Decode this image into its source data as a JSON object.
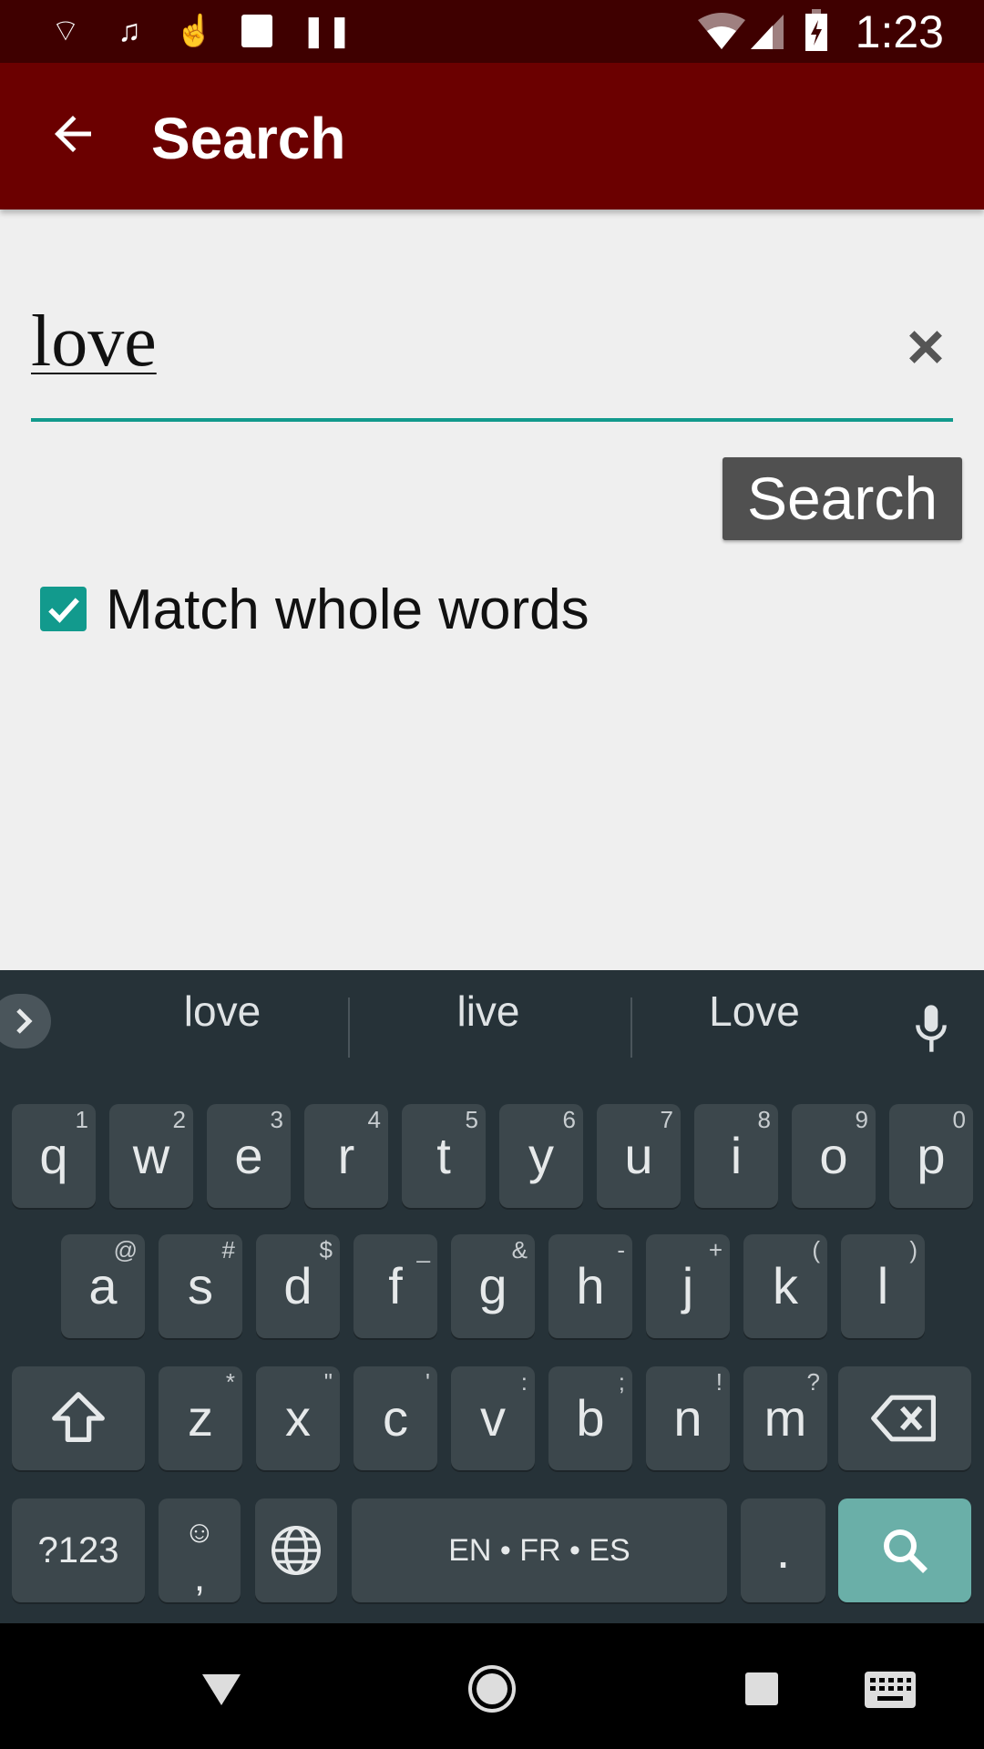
{
  "status_bar": {
    "time": "1:23",
    "left_icons": [
      "cast-wifi-icon",
      "music-icon",
      "touch-icon",
      "image-icon",
      "pause-icon"
    ],
    "right_icons": [
      "wifi-icon",
      "signal-icon",
      "battery-charging-icon"
    ]
  },
  "app_bar": {
    "title": "Search",
    "color": "#6b0000"
  },
  "search": {
    "query": "love",
    "button_label": "Search",
    "match_whole_words_label": "Match whole words",
    "match_whole_words_checked": true,
    "accent": "#129a8d"
  },
  "keyboard": {
    "suggestions": [
      "love",
      "live",
      "Love"
    ],
    "row1": [
      {
        "k": "q",
        "h": "1"
      },
      {
        "k": "w",
        "h": "2"
      },
      {
        "k": "e",
        "h": "3"
      },
      {
        "k": "r",
        "h": "4"
      },
      {
        "k": "t",
        "h": "5"
      },
      {
        "k": "y",
        "h": "6"
      },
      {
        "k": "u",
        "h": "7"
      },
      {
        "k": "i",
        "h": "8"
      },
      {
        "k": "o",
        "h": "9"
      },
      {
        "k": "p",
        "h": "0"
      }
    ],
    "row2": [
      {
        "k": "a",
        "h": "@"
      },
      {
        "k": "s",
        "h": "#"
      },
      {
        "k": "d",
        "h": "$"
      },
      {
        "k": "f",
        "h": "_"
      },
      {
        "k": "g",
        "h": "&"
      },
      {
        "k": "h",
        "h": "-"
      },
      {
        "k": "j",
        "h": "+"
      },
      {
        "k": "k",
        "h": "("
      },
      {
        "k": "l",
        "h": ")"
      }
    ],
    "row3": [
      {
        "k": "z",
        "h": "*"
      },
      {
        "k": "x",
        "h": "\""
      },
      {
        "k": "c",
        "h": "'"
      },
      {
        "k": "v",
        "h": ":"
      },
      {
        "k": "b",
        "h": ";"
      },
      {
        "k": "n",
        "h": "!"
      },
      {
        "k": "m",
        "h": "?"
      }
    ],
    "symbols_label": "?123",
    "comma_label": ",",
    "space_label": "EN • FR • ES",
    "period_label": ".",
    "action_color": "#6aafa8"
  }
}
